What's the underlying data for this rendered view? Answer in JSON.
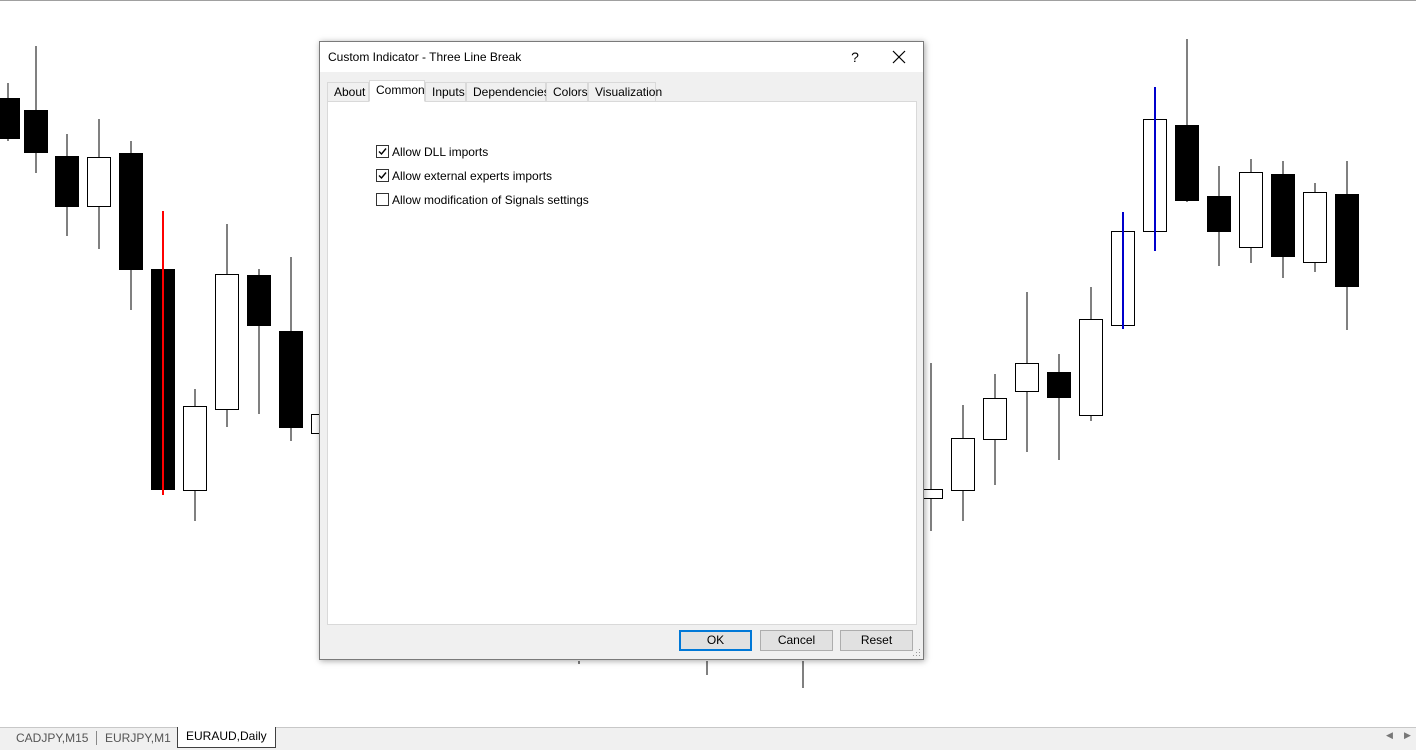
{
  "dialog": {
    "title": "Custom Indicator - Three Line Break",
    "help_label": "?",
    "tabs": [
      {
        "label": "About",
        "selected": false
      },
      {
        "label": "Common",
        "selected": true
      },
      {
        "label": "Inputs",
        "selected": false
      },
      {
        "label": "Dependencies",
        "selected": false
      },
      {
        "label": "Colors",
        "selected": false
      },
      {
        "label": "Visualization",
        "selected": false
      }
    ],
    "checkboxes": [
      {
        "label": "Allow DLL imports",
        "checked": true
      },
      {
        "label": "Allow external experts imports",
        "checked": true
      },
      {
        "label": "Allow modification of Signals settings",
        "checked": false
      }
    ],
    "buttons": {
      "ok": "OK",
      "cancel": "Cancel",
      "reset": "Reset"
    }
  },
  "chart_tabs": [
    {
      "label": "CADJPY,M15",
      "active": false
    },
    {
      "label": "EURJPY,M1",
      "active": false
    },
    {
      "label": "EURAUD,Daily",
      "active": true
    }
  ],
  "colors": {
    "bull_candle": "#ffffff",
    "bear_candle": "#000000",
    "highlight_red": "#ff0000",
    "highlight_blue": "#0000cc",
    "focus_blue": "#0078d7"
  }
}
